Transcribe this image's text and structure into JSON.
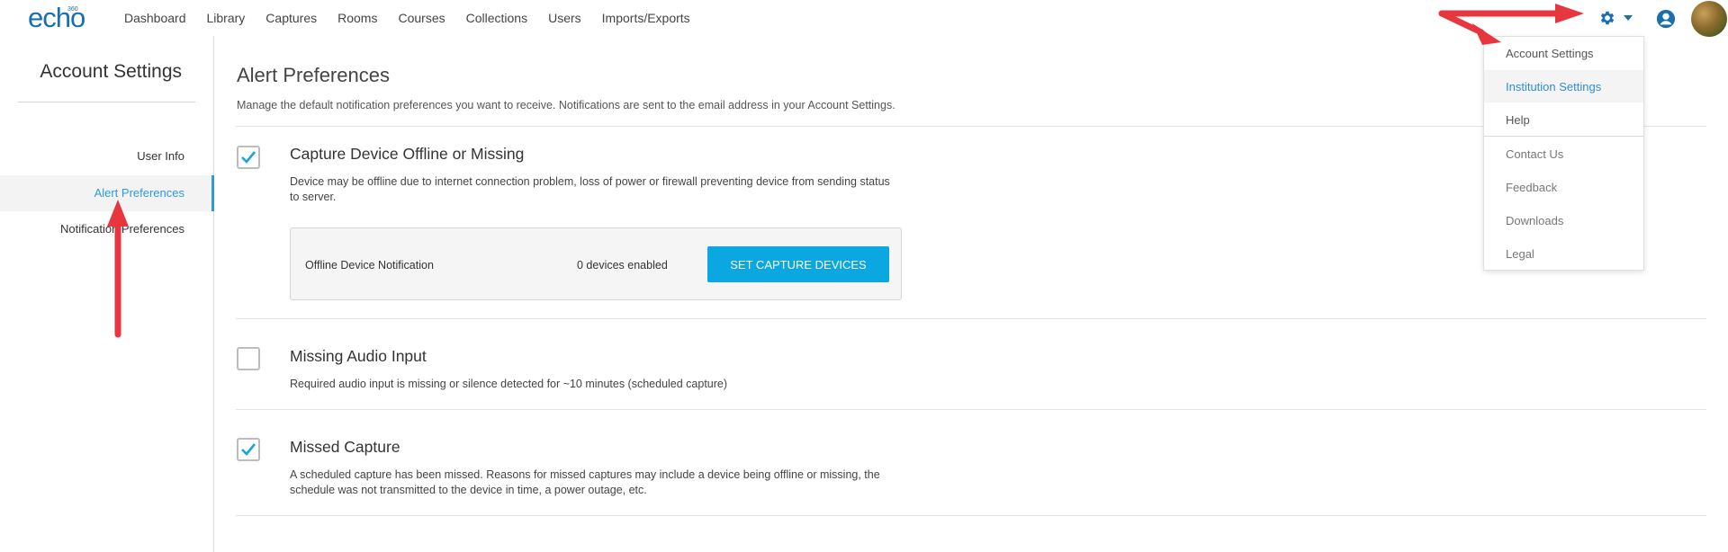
{
  "app": {
    "logo": "echo",
    "logo_superscript": "360"
  },
  "nav": {
    "links": [
      "Dashboard",
      "Library",
      "Captures",
      "Rooms",
      "Courses",
      "Collections",
      "Users",
      "Imports/Exports"
    ]
  },
  "header_icons": {
    "settings": "gear-icon",
    "user": "user-circle-icon"
  },
  "sidebar": {
    "title": "Account Settings",
    "items": [
      {
        "label": "User Info",
        "active": false
      },
      {
        "label": "Alert Preferences",
        "active": true
      },
      {
        "label": "Notification Preferences",
        "active": false
      }
    ]
  },
  "main": {
    "title": "Alert Preferences",
    "description": "Manage the default notification preferences you want to receive. Notifications are sent to the email address in your Account Settings.",
    "alerts": [
      {
        "title": "Capture Device Offline or Missing",
        "description": "Device may be offline due to internet connection problem, loss of power or firewall preventing device from sending status to server.",
        "checked": true
      },
      {
        "title": "Missing Audio Input",
        "description": "Required audio input is missing or silence detected for ~10 minutes (scheduled capture)",
        "checked": false
      },
      {
        "title": "Missed Capture",
        "description": "A scheduled capture has been missed. Reasons for missed captures may include a device being offline or missing, the schedule was not transmitted to the device in time, a power outage, etc.",
        "checked": true
      }
    ],
    "device_box": {
      "label": "Offline Device Notification",
      "count": "0 devices enabled",
      "button": "SET CAPTURE DEVICES"
    }
  },
  "dropdown": {
    "items": [
      "Account Settings",
      "Institution Settings",
      "Help",
      "Contact Us",
      "Feedback",
      "Downloads",
      "Legal"
    ],
    "highlighted": "Institution Settings"
  },
  "colors": {
    "brand": "#1a6fb0",
    "accent": "#2f9bd6",
    "button": "#0aa7e0",
    "annotation_arrow": "#e8363f",
    "checkmark": "#1aa3d9"
  }
}
